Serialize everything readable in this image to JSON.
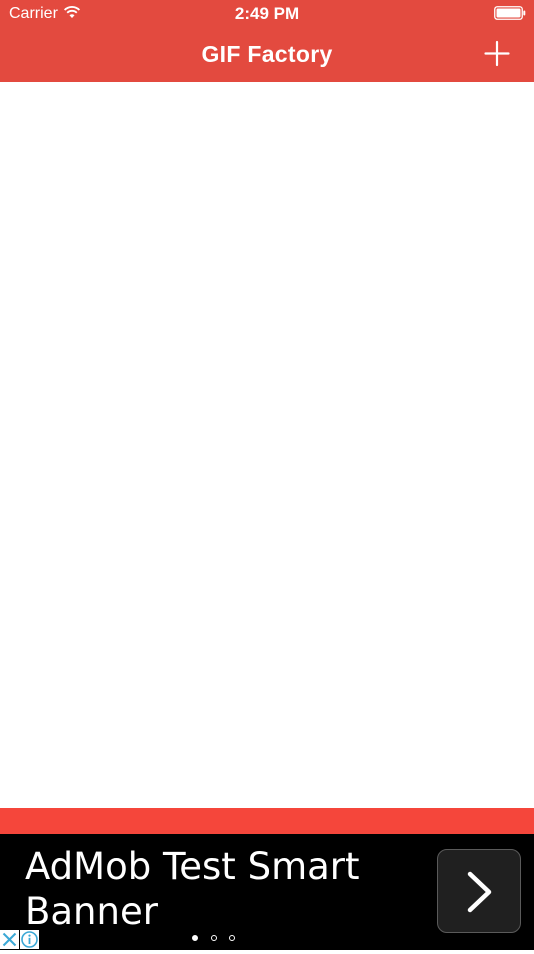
{
  "status_bar": {
    "carrier": "Carrier",
    "time": "2:49 PM",
    "wifi_icon": "wifi-icon",
    "battery_icon": "battery-icon"
  },
  "navigation": {
    "title": "GIF Factory",
    "add_icon": "plus-icon"
  },
  "colors": {
    "nav_background": "#e34a3f",
    "strip": "#f5463b",
    "ad_background": "#000000",
    "text_on_nav": "#ffffff"
  },
  "ad": {
    "text": "AdMob Test Smart Banner",
    "arrow_icon": "chevron-right-icon",
    "close_icon": "close-icon",
    "info_icon": "info-icon",
    "page_count": 3,
    "active_page": 1
  }
}
